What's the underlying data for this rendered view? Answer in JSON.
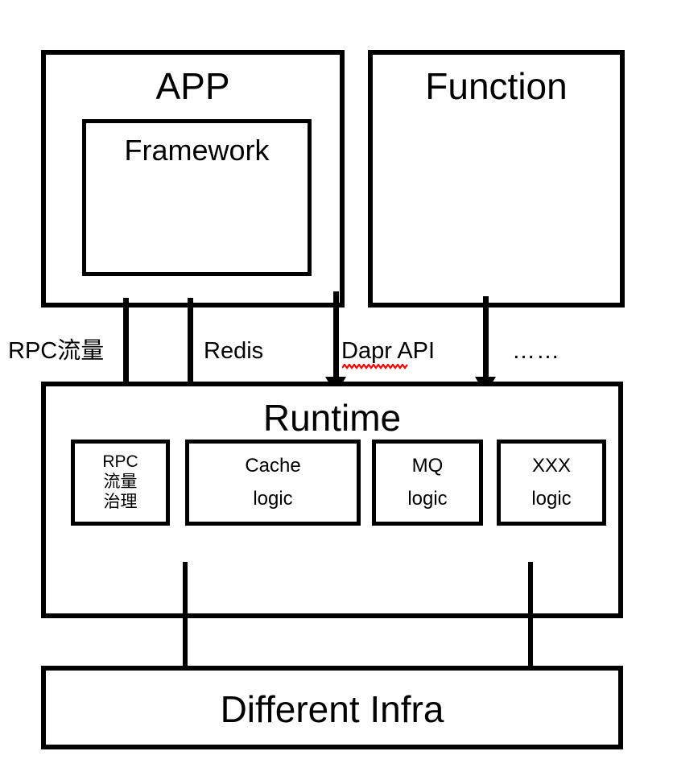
{
  "diagram": {
    "title": "Runtime architecture layering diagram",
    "background_color": "#ffffff",
    "stroke_color": "#000000",
    "spellcheck_underline_color": "#ff0000"
  },
  "layers": {
    "app_box": {
      "title": "APP",
      "inner_box": {
        "title": "Framework"
      }
    },
    "function_box": {
      "title": "Function"
    },
    "runtime_box": {
      "title": "Runtime",
      "components": [
        {
          "lines": [
            "RPC",
            "流量",
            "治理"
          ]
        },
        {
          "lines": [
            "Cache",
            "logic"
          ]
        },
        {
          "lines": [
            "MQ",
            "logic"
          ]
        },
        {
          "lines": [
            "XXX",
            "logic"
          ]
        }
      ]
    },
    "infra_box": {
      "title": "Different Infra"
    }
  },
  "edge_labels": [
    {
      "text": "RPC流量"
    },
    {
      "text": "Redis"
    },
    {
      "text": "Dapr API",
      "spellcheck_error": true
    },
    {
      "text": "……"
    }
  ],
  "arrows": {
    "app_to_runtime": [
      {
        "name": "rpc-traffic-arrow"
      },
      {
        "name": "redis-arrow"
      },
      {
        "name": "dapr-api-arrow"
      }
    ],
    "function_to_runtime": [
      {
        "name": "function-arrow"
      }
    ],
    "runtime_to_infra": [
      {
        "name": "runtime-infra-arrow-left"
      },
      {
        "name": "runtime-infra-arrow-right"
      }
    ]
  }
}
